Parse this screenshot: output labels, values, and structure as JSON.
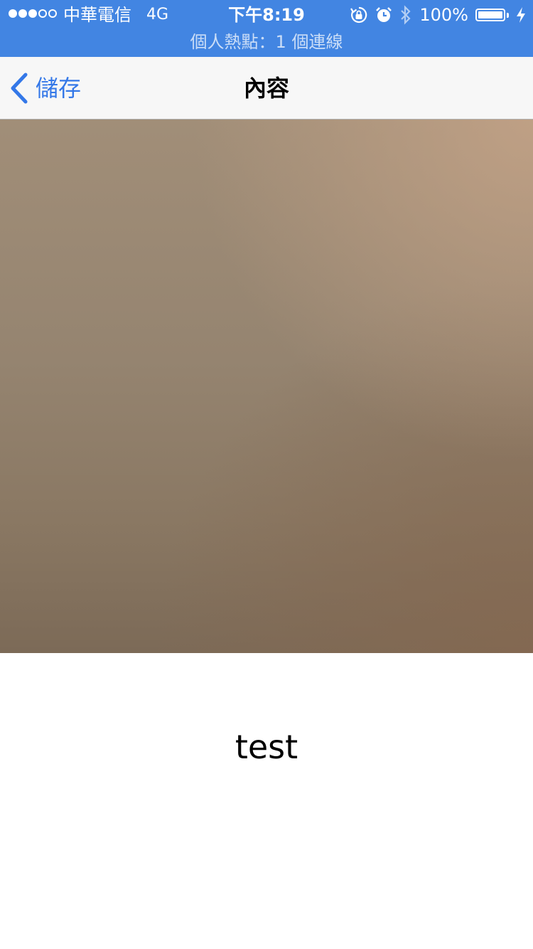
{
  "status_bar": {
    "signal_strength": 3,
    "signal_max": 5,
    "carrier": "中華電信",
    "network": "4G",
    "time": "下午8:19",
    "battery_percent": "100%",
    "icons": [
      "rotation-lock-icon",
      "alarm-icon",
      "bluetooth-icon",
      "battery-icon",
      "charging-bolt-icon"
    ],
    "hotspot": "個人熱點：1 個連線",
    "background_color": "#4285e2"
  },
  "nav": {
    "back_label": "儲存",
    "title": "內容",
    "accent_color": "#3478e8"
  },
  "content": {
    "caption": "test"
  }
}
